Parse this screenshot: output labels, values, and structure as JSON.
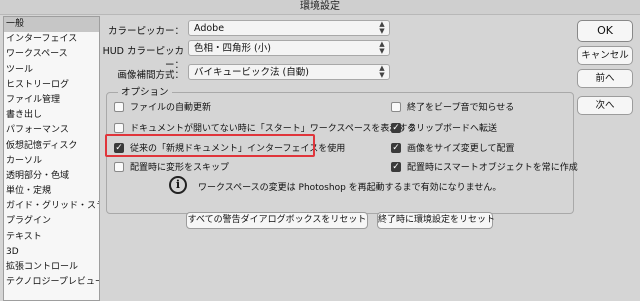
{
  "window": {
    "title": "環境設定"
  },
  "sidebar": {
    "items": [
      {
        "label": "一般"
      },
      {
        "label": "インターフェイス"
      },
      {
        "label": "ワークスペース"
      },
      {
        "label": "ツール"
      },
      {
        "label": "ヒストリーログ"
      },
      {
        "label": "ファイル管理"
      },
      {
        "label": "書き出し"
      },
      {
        "label": "パフォーマンス"
      },
      {
        "label": "仮想記憶ディスク"
      },
      {
        "label": "カーソル"
      },
      {
        "label": "透明部分・色域"
      },
      {
        "label": "単位・定規"
      },
      {
        "label": "ガイド・グリッド・スライス"
      },
      {
        "label": "プラグイン"
      },
      {
        "label": "テキスト"
      },
      {
        "label": "3D"
      },
      {
        "label": "拡張コントロール"
      },
      {
        "label": "テクノロジープレビュー"
      }
    ],
    "selected_index": 0
  },
  "fields": {
    "color_picker": {
      "label": "カラーピッカー：",
      "value": "Adobe"
    },
    "hud_color_picker": {
      "label": "HUD カラーピッカー：",
      "value": "色相・四角形 (小)"
    },
    "interpolation": {
      "label": "画像補間方式：",
      "value": "バイキュービック法 (自動)"
    }
  },
  "options": {
    "title": "オプション",
    "left": [
      {
        "label": "ファイルの自動更新",
        "checked": false
      },
      {
        "label": "ドキュメントが開いてない時に「スタート」ワークスペースを表示する",
        "checked": false
      },
      {
        "label": "従来の「新規ドキュメント」インターフェイスを使用",
        "checked": true
      },
      {
        "label": "配置時に変形をスキップ",
        "checked": false
      }
    ],
    "right": [
      {
        "label": "終了をビープ音で知らせる",
        "checked": false
      },
      {
        "label": "クリップボードへ転送",
        "checked": true
      },
      {
        "label": "画像をサイズ変更して配置",
        "checked": true
      },
      {
        "label": "配置時にスマートオブジェクトを常に作成",
        "checked": true
      }
    ],
    "info": "ワークスペースの変更は Photoshop を再起動するまで有効になりません。"
  },
  "bottom_buttons": {
    "reset_warnings": "すべての警告ダイアログボックスをリセット",
    "reset_on_quit": "終了時に環境設定をリセット"
  },
  "side_buttons": {
    "ok": "OK",
    "cancel": "キャンセル",
    "prev": "前へ",
    "next": "次へ"
  },
  "colors": {
    "highlight": "#e0353b",
    "selected": "#c6c6c6"
  }
}
